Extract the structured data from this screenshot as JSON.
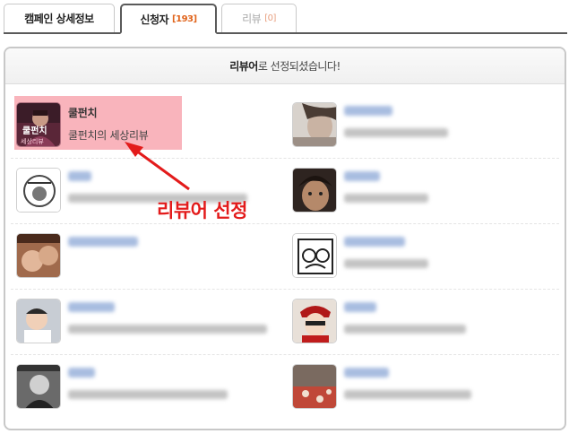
{
  "tabs": [
    {
      "label": "캠페인 상세정보",
      "count": ""
    },
    {
      "label": "신청자",
      "count": "[193]"
    },
    {
      "label": "리뷰",
      "count": "[0]"
    }
  ],
  "banner": {
    "bold": "리뷰어",
    "rest": "로 선정되셨습니다!"
  },
  "selected_reviewer": {
    "name": "쿨펀치",
    "blog": "쿨펀치의 세상리뷰",
    "avatar_caption_1": "쿨펀치",
    "avatar_caption_2": "세상리뷰"
  },
  "annotation": "리뷰어 선정",
  "colors": {
    "accent_tab_count": "#e0641c",
    "highlight": "#f9b0b8",
    "annotation_red": "#e31b1b",
    "blurred_name": "#9fb6dd"
  },
  "applicants_blurred": [
    {
      "position": "right-1",
      "name_blurred": true
    },
    {
      "position": "left-2",
      "name_blurred": true
    },
    {
      "position": "right-2",
      "name_blurred": true
    },
    {
      "position": "left-3",
      "name_blurred": true
    },
    {
      "position": "right-3",
      "name_blurred": true
    },
    {
      "position": "left-4",
      "name_blurred": true
    },
    {
      "position": "right-4",
      "name_blurred": true
    },
    {
      "position": "left-5",
      "name_blurred": true
    },
    {
      "position": "right-5",
      "name_blurred": true
    }
  ]
}
